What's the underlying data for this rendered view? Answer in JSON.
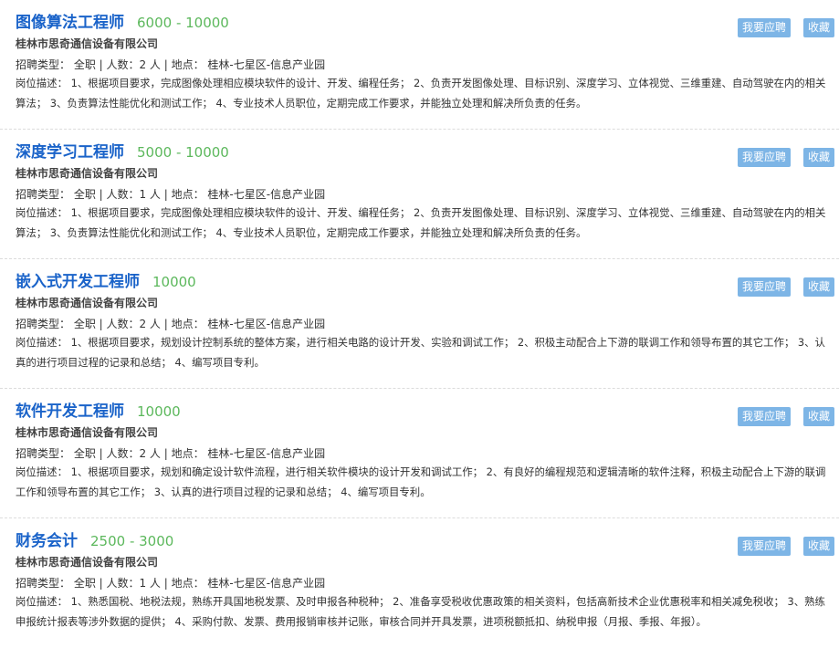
{
  "jobs": [
    {
      "title": "图像算法工程师",
      "salary": "6000 - 10000",
      "company": "桂林市思奇通信设备有限公司",
      "meta": "招聘类型： 全职 | 人数：2 人 | 地点： 桂林-七星区-信息产业园",
      "desc": "岗位描述： 1、根据项目要求，完成图像处理相应模块软件的设计、开发、编程任务； 2、负责开发图像处理、目标识别、深度学习、立体视觉、三维重建、自动驾驶在内的相关算法； 3、负责算法性能优化和测试工作； 4、专业技术人员职位，定期完成工作要求，并能独立处理和解决所负责的任务。",
      "apply_label": "我要应聘",
      "fav_label": "收藏"
    },
    {
      "title": "深度学习工程师",
      "salary": "5000 - 10000",
      "company": "桂林市思奇通信设备有限公司",
      "meta": "招聘类型： 全职 | 人数：1 人 | 地点： 桂林-七星区-信息产业园",
      "desc": "岗位描述： 1、根据项目要求，完成图像处理相应模块软件的设计、开发、编程任务； 2、负责开发图像处理、目标识别、深度学习、立体视觉、三维重建、自动驾驶在内的相关算法； 3、负责算法性能优化和测试工作； 4、专业技术人员职位，定期完成工作要求，并能独立处理和解决所负责的任务。",
      "apply_label": "我要应聘",
      "fav_label": "收藏"
    },
    {
      "title": "嵌入式开发工程师",
      "salary": "10000",
      "company": "桂林市思奇通信设备有限公司",
      "meta": "招聘类型： 全职 | 人数：2 人 | 地点： 桂林-七星区-信息产业园",
      "desc": "岗位描述： 1、根据项目要求，规划设计控制系统的整体方案，进行相关电路的设计开发、实验和调试工作； 2、积极主动配合上下游的联调工作和领导布置的其它工作； 3、认真的进行项目过程的记录和总结； 4、编写项目专利。",
      "apply_label": "我要应聘",
      "fav_label": "收藏"
    },
    {
      "title": "软件开发工程师",
      "salary": "10000",
      "company": "桂林市思奇通信设备有限公司",
      "meta": "招聘类型： 全职 | 人数：2 人 | 地点： 桂林-七星区-信息产业园",
      "desc": "岗位描述： 1、根据项目要求，规划和确定设计软件流程，进行相关软件模块的设计开发和调试工作； 2、有良好的编程规范和逻辑清晰的软件注释，积极主动配合上下游的联调工作和领导布置的其它工作； 3、认真的进行项目过程的记录和总结； 4、编写项目专利。",
      "apply_label": "我要应聘",
      "fav_label": "收藏"
    },
    {
      "title": "财务会计",
      "salary": "2500 - 3000",
      "company": "桂林市思奇通信设备有限公司",
      "meta": "招聘类型： 全职 | 人数：1 人 | 地点： 桂林-七星区-信息产业园",
      "desc": "岗位描述： 1、熟悉国税、地税法规，熟练开具国地税发票、及时申报各种税种； 2、准备享受税收优惠政策的相关资料，包括高新技术企业优惠税率和相关减免税收； 3、熟练申报统计报表等涉外数据的提供； 4、采购付款、发票、费用报销审核并记账，审核合同并开具发票，进项税额抵扣、纳税申报（月报、季报、年报）。",
      "apply_label": "我要应聘",
      "fav_label": "收藏"
    }
  ]
}
